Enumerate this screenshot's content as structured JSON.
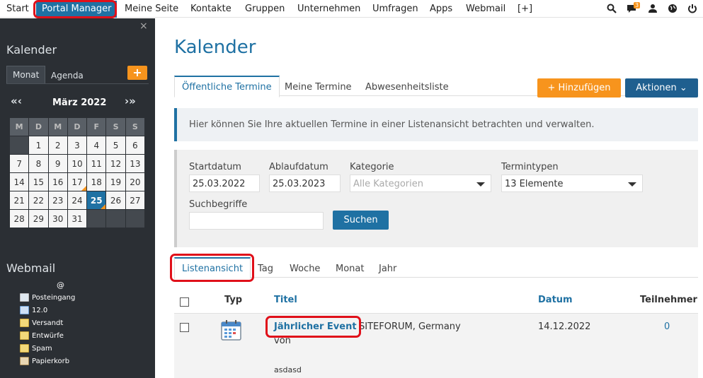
{
  "topnav": {
    "items": [
      "Start",
      "Portal Manager",
      "Meine Seite",
      "Kontakte",
      "Gruppen",
      "Unternehmen",
      "Umfragen",
      "Apps",
      "Webmail",
      "[+]"
    ],
    "badge_count": "3"
  },
  "sidebar": {
    "close_label": "×",
    "calendar_title": "Kalender",
    "tab_month": "Monat",
    "tab_agenda": "Agenda",
    "add_label": "+",
    "prev_label": "«‹",
    "next_label": "›»",
    "month_label": "März 2022",
    "weekdays": [
      "M",
      "D",
      "M",
      "D",
      "F",
      "S",
      "S"
    ],
    "weeks": [
      [
        "",
        "1",
        "2",
        "3",
        "4",
        "5",
        "6"
      ],
      [
        "7",
        "8",
        "9",
        "10",
        "11",
        "12",
        "13"
      ],
      [
        "14",
        "15",
        "16",
        "17",
        "18",
        "19",
        "20"
      ],
      [
        "21",
        "22",
        "23",
        "24",
        "25",
        "26",
        "27"
      ],
      [
        "28",
        "29",
        "30",
        "31",
        "",
        "",
        ""
      ]
    ],
    "webmail_title": "Webmail",
    "webmail_at": "@",
    "mail_items": [
      "Posteingang",
      "12.0",
      "Versandt",
      "Entwürfe",
      "Spam",
      "Papierkorb"
    ]
  },
  "main": {
    "title": "Kalender",
    "tabs": [
      "Öffentliche Termine",
      "Meine Termine",
      "Abwesenheitsliste"
    ],
    "add_button": "Hinzufügen",
    "actions_button": "Aktionen",
    "info_text": "Hier können Sie Ihre aktuellen Termine in einer Listenansicht betrachten und verwalten.",
    "filter": {
      "start_label": "Startdatum",
      "start_value": "25.03.2022",
      "end_label": "Ablaufdatum",
      "end_value": "25.03.2023",
      "category_label": "Kategorie",
      "category_placeholder": "Alle Kategorien",
      "types_label": "Termintypen",
      "types_value": "13 Elemente",
      "search_label": "Suchbegriffe",
      "search_value": "",
      "search_button": "Suchen"
    },
    "view_tabs": [
      "Listenansicht",
      "Tag",
      "Woche",
      "Monat",
      "Jahr"
    ],
    "table": {
      "headers": [
        "Typ",
        "Titel",
        "Datum",
        "Teilnehmer"
      ],
      "rows": [
        {
          "title": "Jährlicher Event",
          "location": "SITEFORUM, Germany",
          "by": "von",
          "desc": "asdasd",
          "date": "14.12.2022",
          "participants": "0"
        }
      ]
    }
  }
}
